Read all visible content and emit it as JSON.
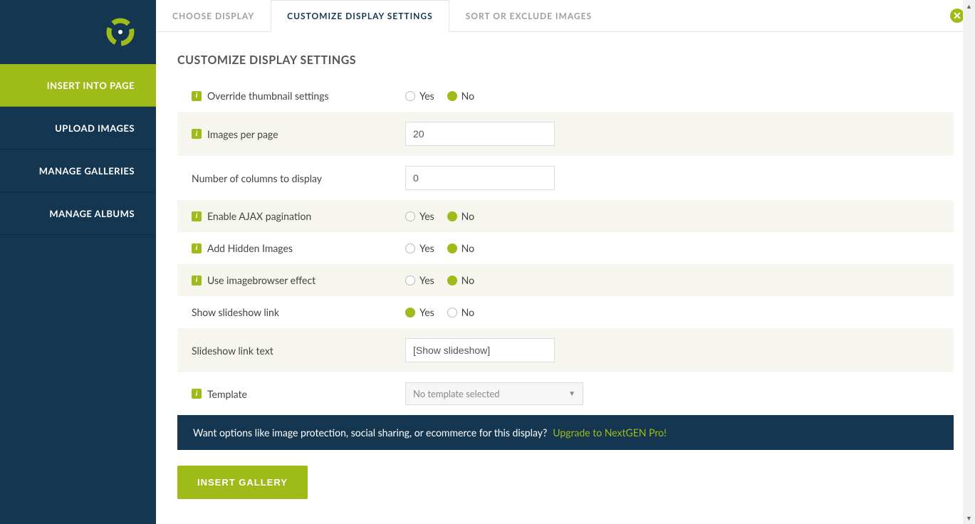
{
  "sidebar": {
    "items": [
      {
        "label": "INSERT INTO PAGE",
        "active": true
      },
      {
        "label": "UPLOAD IMAGES",
        "active": false
      },
      {
        "label": "MANAGE GALLERIES",
        "active": false
      },
      {
        "label": "MANAGE ALBUMS",
        "active": false
      }
    ]
  },
  "tabs": [
    {
      "label": "CHOOSE DISPLAY",
      "active": false
    },
    {
      "label": "CUSTOMIZE DISPLAY SETTINGS",
      "active": true
    },
    {
      "label": "SORT OR EXCLUDE IMAGES",
      "active": false
    }
  ],
  "page_title": "CUSTOMIZE DISPLAY SETTINGS",
  "labels": {
    "yes": "Yes",
    "no": "No"
  },
  "settings": {
    "override_thumbnail": {
      "label": "Override thumbnail settings",
      "info": true,
      "value": "no"
    },
    "images_per_page": {
      "label": "Images per page",
      "info": true,
      "value": "20"
    },
    "num_columns": {
      "label": "Number of columns to display",
      "info": false,
      "value": "0"
    },
    "enable_ajax": {
      "label": "Enable AJAX pagination",
      "info": true,
      "value": "no"
    },
    "add_hidden": {
      "label": "Add Hidden Images",
      "info": true,
      "value": "no"
    },
    "imagebrowser": {
      "label": "Use imagebrowser effect",
      "info": true,
      "value": "no"
    },
    "show_slideshow": {
      "label": "Show slideshow link",
      "info": false,
      "value": "yes"
    },
    "slideshow_text": {
      "label": "Slideshow link text",
      "info": false,
      "value": "[Show slideshow]"
    },
    "template": {
      "label": "Template",
      "info": true,
      "value": "No template selected"
    }
  },
  "upsell": {
    "text": "Want options like image protection, social sharing, or ecommerce for this display?",
    "link": "Upgrade to NextGEN Pro!"
  },
  "insert_button": "INSERT GALLERY"
}
